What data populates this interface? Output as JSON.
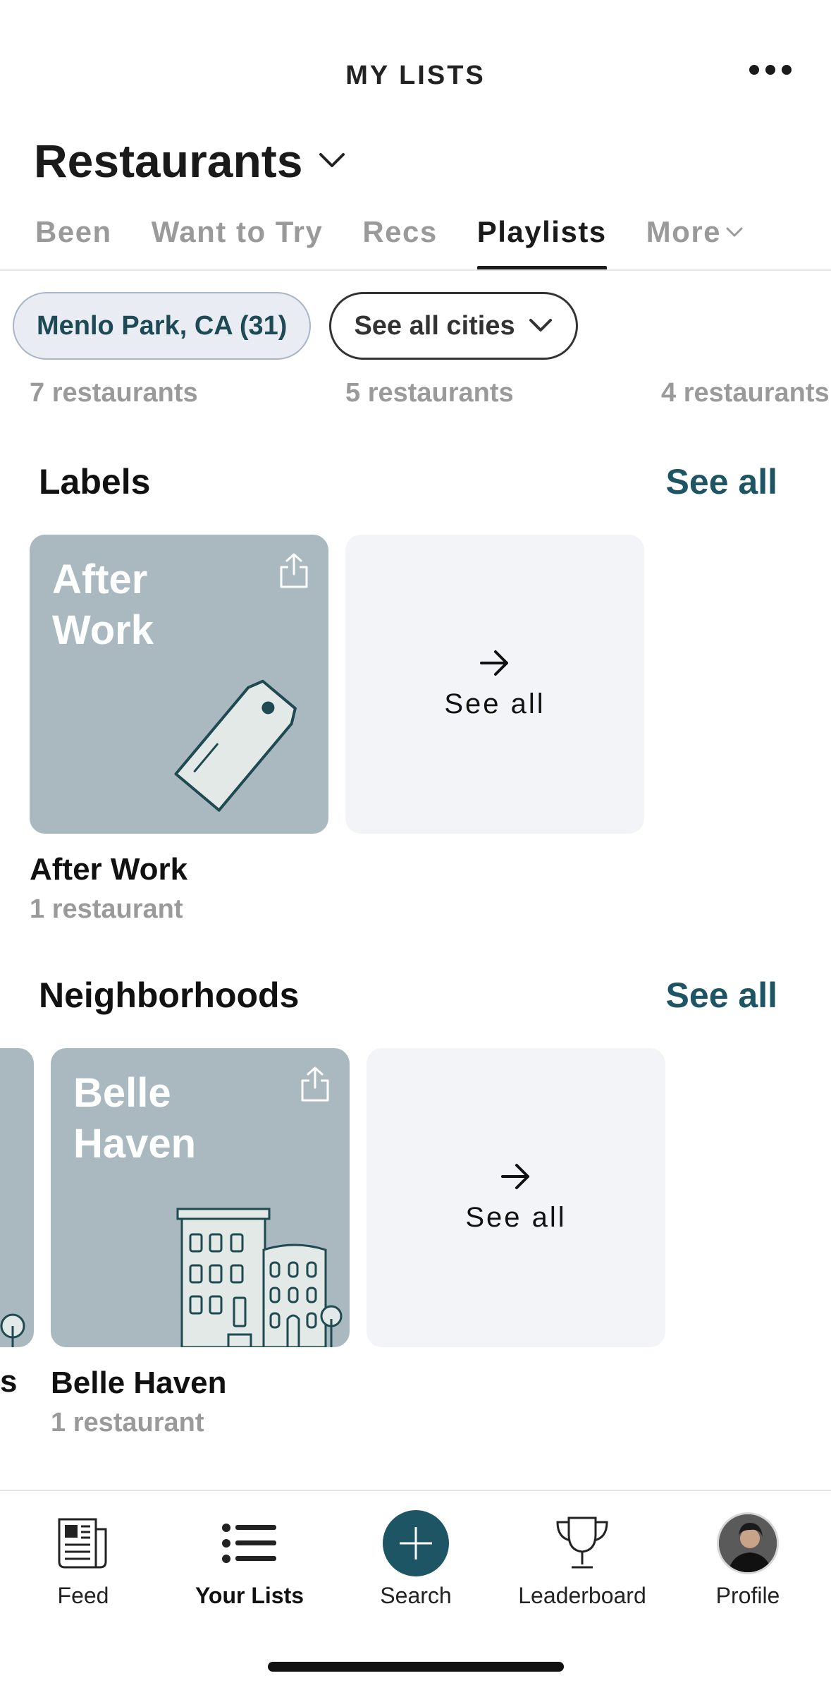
{
  "header": {
    "title": "MY LISTS",
    "list_name": "Restaurants"
  },
  "tabs": [
    {
      "label": "Been",
      "active": false
    },
    {
      "label": "Want to Try",
      "active": false
    },
    {
      "label": "Recs",
      "active": false
    },
    {
      "label": "Playlists",
      "active": true
    },
    {
      "label": "More",
      "active": false
    }
  ],
  "filters": {
    "city_chip": "Menlo Park, CA (31)",
    "all_cities_chip": "See all cities"
  },
  "peek_counts": [
    "7 restaurants",
    "5 restaurants",
    "4 restaurants"
  ],
  "labels_section": {
    "title": "Labels",
    "see_all": "See all",
    "cards": [
      {
        "title_line1": "After",
        "title_line2": "Work",
        "caption": "After Work",
        "count": "1 restaurant",
        "icon": "tag-icon"
      }
    ],
    "see_all_card": "See all"
  },
  "neighborhoods_section": {
    "title": "Neighborhoods",
    "see_all": "See all",
    "peek_caption": "s",
    "cards": [
      {
        "title_line1": "Belle",
        "title_line2": "Haven",
        "caption": "Belle Haven",
        "count": "1 restaurant",
        "icon": "buildings-icon"
      }
    ],
    "see_all_card": "See all"
  },
  "bottom_nav": [
    {
      "label": "Feed",
      "icon": "newspaper-icon",
      "active": false
    },
    {
      "label": "Your Lists",
      "icon": "list-icon",
      "active": true
    },
    {
      "label": "Search",
      "icon": "plus-icon",
      "active": false
    },
    {
      "label": "Leaderboard",
      "icon": "trophy-icon",
      "active": false
    },
    {
      "label": "Profile",
      "icon": "avatar",
      "active": false
    }
  ],
  "colors": {
    "accent": "#1d5564",
    "card_bg": "#a9b9bf",
    "see_all_card_bg": "#f3f4f7",
    "muted_text": "#9a9a9a"
  }
}
